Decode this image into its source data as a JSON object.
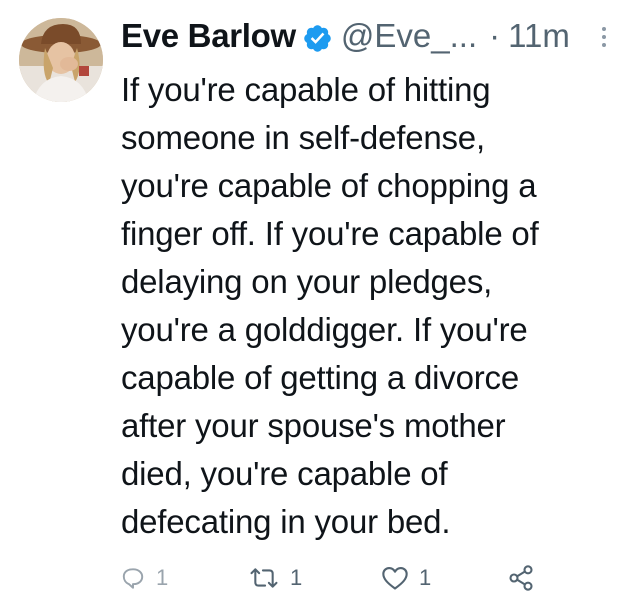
{
  "tweet": {
    "author": {
      "display_name": "Eve Barlow",
      "handle": "@Eve_...",
      "verified": true
    },
    "separator": "·",
    "timestamp": "11m",
    "lines": [
      "If you're capable of hitting",
      "someone in self-defense,",
      "you're capable of chopping a",
      "finger off. If you're capable of",
      "delaying on your pledges,",
      "you're a golddigger. If you're",
      "capable of getting a divorce",
      "after your spouse's mother",
      "died, you're capable of",
      "defecating in your bed."
    ],
    "actions": {
      "reply_count": "1",
      "retweet_count": "1",
      "like_count": "1"
    }
  },
  "colors": {
    "text": "#0f1419",
    "secondary": "#536471",
    "verified_badge": "#1d9bf0"
  },
  "icons": {
    "verified": "verified-badge-icon",
    "more": "more-vertical-icon",
    "reply": "reply-bubble-icon",
    "retweet": "retweet-icon",
    "like": "heart-icon",
    "share": "share-icon"
  }
}
